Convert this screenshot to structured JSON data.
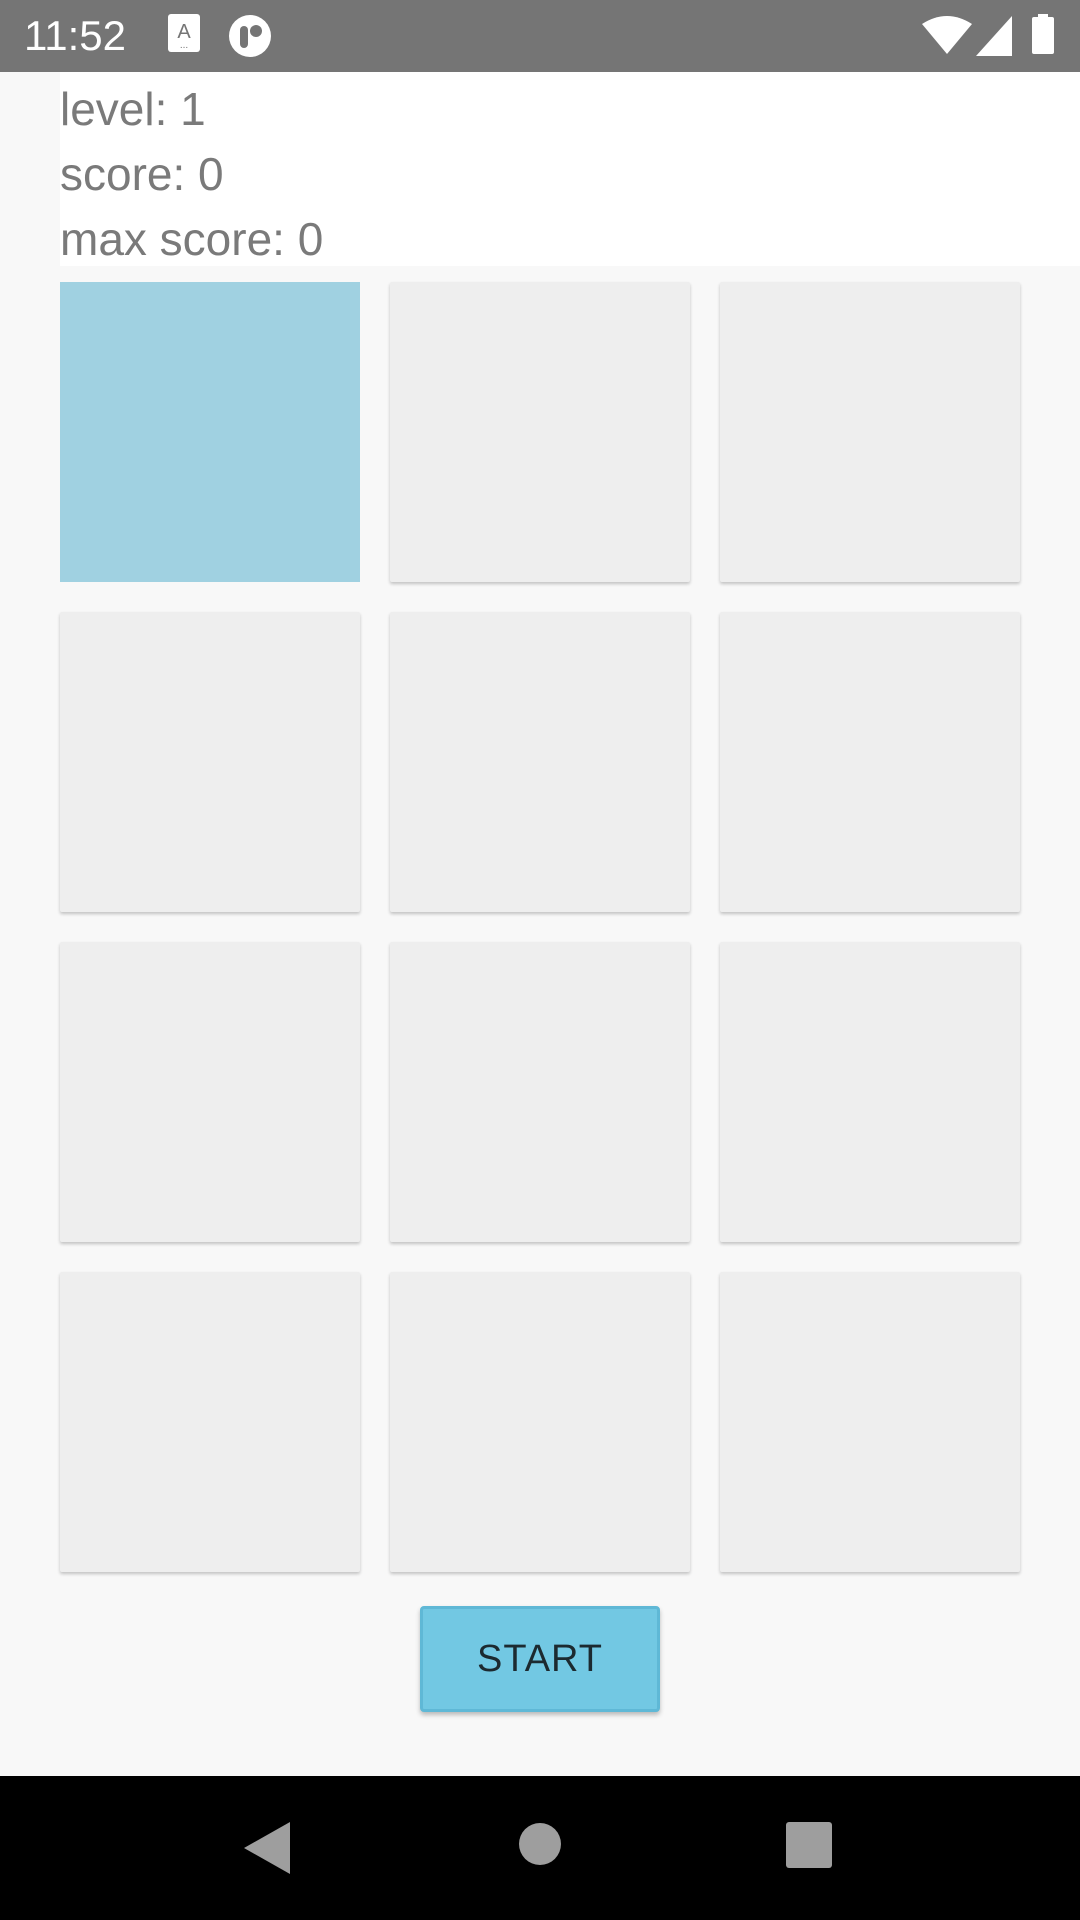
{
  "status_bar": {
    "time": "11:52",
    "icons": [
      "notification-a-icon",
      "notification-circle-icon",
      "wifi-icon",
      "signal-icon",
      "battery-icon"
    ]
  },
  "info": {
    "level": "level: 1",
    "score": "score: 0",
    "max_score": "max score: 0"
  },
  "grid": {
    "rows": 4,
    "cols": 3,
    "highlighted_tile": 0,
    "tile_color": "#eeeeee",
    "highlight_color": "#a0d1e1"
  },
  "start_button": {
    "label": "START",
    "color": "#72c8e3"
  },
  "nav_bar": {
    "buttons": [
      "back-icon",
      "home-icon",
      "recents-icon"
    ]
  }
}
